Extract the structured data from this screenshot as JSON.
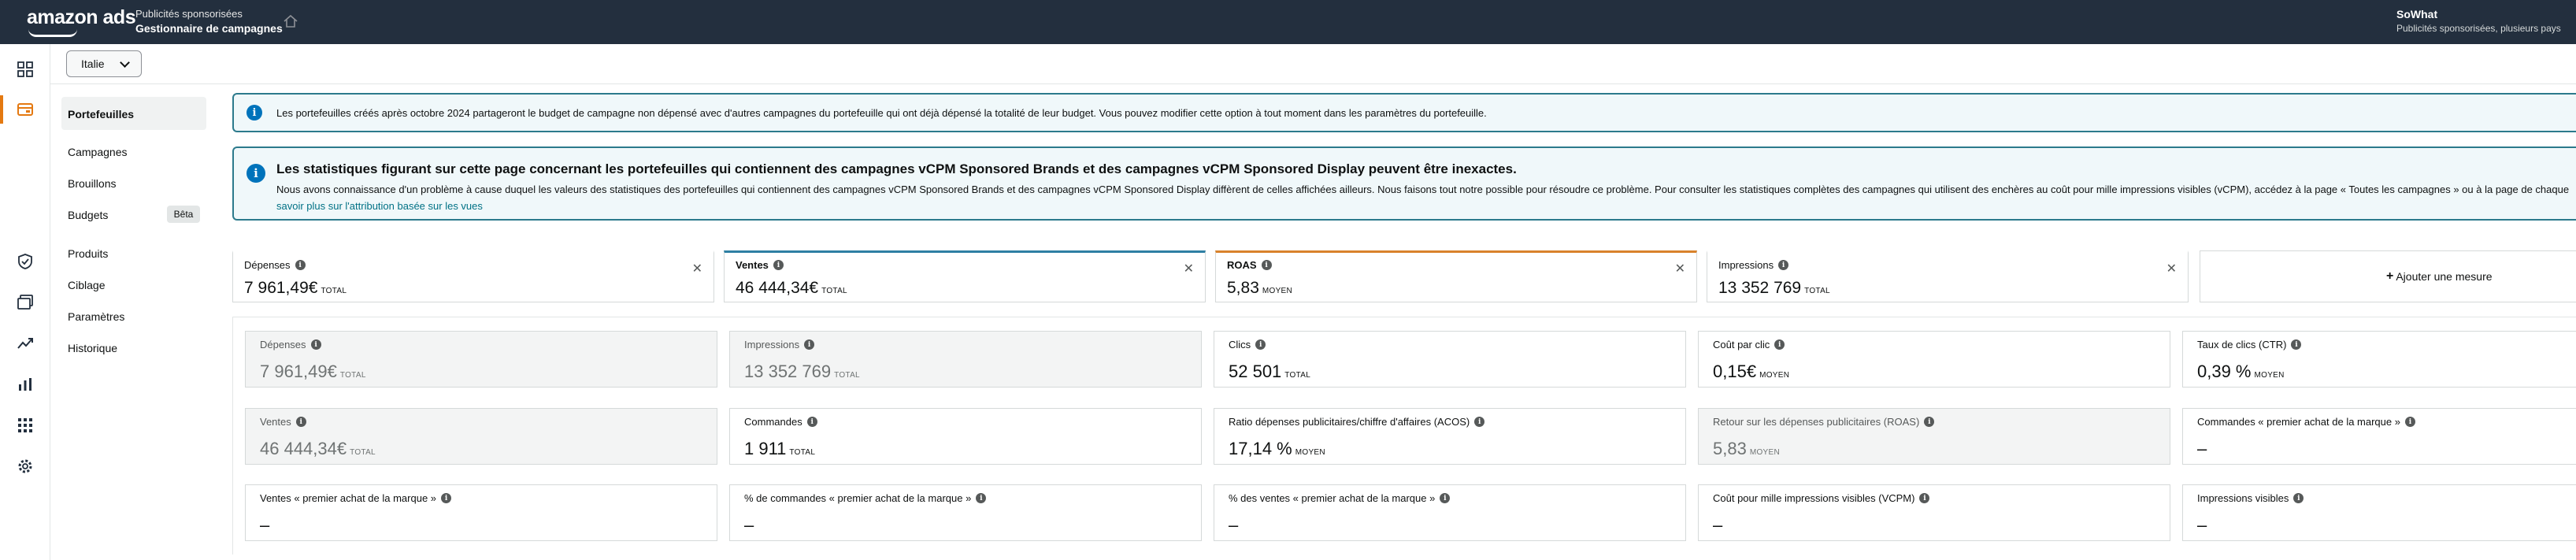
{
  "topbar": {
    "logo": "amazon ads",
    "subtitle": "Publicités sponsorisées",
    "title": "Gestionnaire de campagnes",
    "account_name": "SoWhat",
    "account_sub": "Publicités sponsorisées, plusieurs pays"
  },
  "rail_icons": [
    "grid-icon",
    "campaign-manager-icon",
    "shield-icon",
    "media-icon",
    "trend-icon",
    "bar-chart-icon",
    "apps-icon",
    "settings-icon"
  ],
  "country": {
    "value": "Italie"
  },
  "sidenav": {
    "selected": "Portefeuilles",
    "items": [
      "Campagnes",
      "Brouillons",
      "Budgets",
      "Produits",
      "Ciblage",
      "Paramètres",
      "Historique"
    ],
    "beta_badge": "Bêta"
  },
  "alerts": {
    "portfolio_budget": "Les portefeuilles créés après octobre 2024 partageront le budget de campagne non dépensé avec d'autres campagnes du portefeuille qui ont déjà dépensé la totalité de leur budget. Vous pouvez modifier cette option à tout moment dans les paramètres du portefeuille.",
    "vcpm_title": "Les statistiques figurant sur cette page concernant les portefeuilles qui contiennent des campagnes vCPM Sponsored Brands et des campagnes vCPM Sponsored Display peuvent être inexactes.",
    "vcpm_body": "Nous avons connaissance d'un problème à cause duquel les valeurs des statistiques des portefeuilles qui contiennent des campagnes vCPM Sponsored Brands et des campagnes vCPM Sponsored Display diffèrent de celles affichées ailleurs. Nous faisons tout notre possible pour résoudre ce problème. Pour consulter les statistiques complètes des campagnes qui utilisent des enchères au coût pour mille impressions visibles (vCPM), accédez à la page « Toutes les campagnes » ou à la page de chaque",
    "vcpm_link": "savoir plus sur l'attribution basée sur les vues"
  },
  "metric_cards": [
    {
      "label": "Dépenses",
      "value": "7 961,49€",
      "unit": "TOTAL",
      "accent": ""
    },
    {
      "label": "Ventes",
      "value": "46 444,34€",
      "unit": "TOTAL",
      "accent": "#2e7fa3"
    },
    {
      "label": "ROAS",
      "value": "5,83",
      "unit": "MOYEN",
      "accent": "#d9822b"
    },
    {
      "label": "Impressions",
      "value": "13 352 769",
      "unit": "TOTAL",
      "accent": ""
    }
  ],
  "add_metric": "Ajouter une mesure",
  "tiles": [
    {
      "label": "Dépenses",
      "value": "7 961,49€",
      "unit": "TOTAL",
      "disabled": true
    },
    {
      "label": "Impressions",
      "value": "13 352 769",
      "unit": "TOTAL",
      "disabled": true
    },
    {
      "label": "Clics",
      "value": "52 501",
      "unit": "TOTAL",
      "disabled": false
    },
    {
      "label": "Coût par clic",
      "value": "0,15€",
      "unit": "MOYEN",
      "disabled": false
    },
    {
      "label": "Taux de clics (CTR)",
      "value": "0,39 %",
      "unit": "MOYEN",
      "disabled": false
    },
    {
      "label": "Ventes",
      "value": "46 444,34€",
      "unit": "TOTAL",
      "disabled": true
    },
    {
      "label": "Commandes",
      "value": "1 911",
      "unit": "TOTAL",
      "disabled": false
    },
    {
      "label": "Ratio dépenses publicitaires/chiffre d'affaires (ACOS)",
      "value": "17,14 %",
      "unit": "MOYEN",
      "disabled": false
    },
    {
      "label": "Retour sur les dépenses publicitaires (ROAS)",
      "value": "5,83",
      "unit": "MOYEN",
      "disabled": true
    },
    {
      "label": "Commandes « premier achat de la marque »",
      "value": "–",
      "unit": "",
      "disabled": false
    },
    {
      "label": "Ventes « premier achat de la marque »",
      "value": "–",
      "unit": "",
      "disabled": false
    },
    {
      "label": "% de commandes « premier achat de la marque »",
      "value": "–",
      "unit": "",
      "disabled": false
    },
    {
      "label": "% des ventes « premier achat de la marque »",
      "value": "–",
      "unit": "",
      "disabled": false
    },
    {
      "label": "Coût pour mille impressions visibles (VCPM)",
      "value": "–",
      "unit": "",
      "disabled": false
    },
    {
      "label": "Impressions visibles",
      "value": "–",
      "unit": "",
      "disabled": false
    }
  ],
  "colors": {
    "topbar": "#232f3e",
    "active": "#e47911",
    "alert_border": "#2c7a8c",
    "info": "#0073bb"
  }
}
